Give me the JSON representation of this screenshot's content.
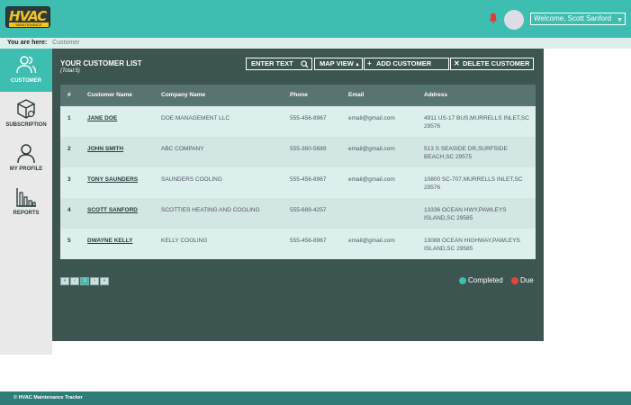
{
  "header": {
    "logo_main": "HVAC",
    "logo_sub": "MAINTENANCE TRACKER",
    "welcome": "Welcome, Scott Sanford"
  },
  "breadcrumb": {
    "prefix": "You are here:",
    "current": "Customer"
  },
  "sidebar": {
    "items": [
      {
        "label": "CUSTOMER",
        "icon": "users-icon",
        "active": true
      },
      {
        "label": "SUBSCRIPTION",
        "icon": "box-icon",
        "active": false
      },
      {
        "label": "MY PROFILE",
        "icon": "user-icon",
        "active": false
      },
      {
        "label": "REPORTS",
        "icon": "bar-chart-icon",
        "active": false
      }
    ]
  },
  "list": {
    "title": "YOUR CUSTOMER LIST",
    "total": "(Total:5)"
  },
  "toolbar": {
    "search_placeholder": "ENTER TEXT",
    "map_view": "MAP VIEW",
    "add_customer": "ADD CUSTOMER",
    "delete_customer": "DELETE CUSTOMER"
  },
  "table": {
    "columns": [
      "#",
      "Customer Name",
      "Company Name",
      "Phone",
      "Email",
      "Address"
    ],
    "rows": [
      {
        "num": "1",
        "name": "JANE DOE",
        "company": "DOE MANAGEMENT LLC",
        "phone": "555-456-8967",
        "email": "email@gmail.com",
        "address1": "4911 US-17 BUS,MURRELLS INLET,SC",
        "address2": "29576"
      },
      {
        "num": "2",
        "name": "JOHN SMITH",
        "company": "ABC COMPANY",
        "phone": "555-360-5689",
        "email": "email@gmail.com",
        "address1": "513 S SEASIDE DR,SURFSIDE",
        "address2": "BEACH,SC 29575"
      },
      {
        "num": "3",
        "name": "TONY SAUNDERS",
        "company": "SAUNDERS COOLING",
        "phone": "555-456-8967",
        "email": "email@gmail.com",
        "address1": "10800 SC-707,MURRELLS INLET,SC",
        "address2": "29576"
      },
      {
        "num": "4",
        "name": "SCOTT SANFORD",
        "company": "SCOTTIES HEATING AND COOLING",
        "phone": "555-689-4257",
        "email": "",
        "address1": "13336 OCEAN HWY,PAWLEYS",
        "address2": "ISLAND,SC 29585"
      },
      {
        "num": "5",
        "name": "DWAYNE KELLY",
        "company": "KELLY COOLING",
        "phone": "555-456-8967",
        "email": "email@gmail.com",
        "address1": "13088 OCEAN HIGHWAY,PAWLEYS",
        "address2": "ISLAND,SC 29585"
      }
    ]
  },
  "pagination": {
    "first": "«",
    "prev": "‹",
    "current": "1",
    "next": "›",
    "last": "»"
  },
  "legend": {
    "completed": "Completed",
    "due": "Due",
    "completed_color": "#3ebdb1",
    "due_color": "#e2463c"
  },
  "footer": {
    "text": "© HVAC Maintenance Tracker"
  },
  "colors": {
    "accent": "#3ebdb1",
    "panel": "#3c5551",
    "footer": "#2e7d76"
  }
}
